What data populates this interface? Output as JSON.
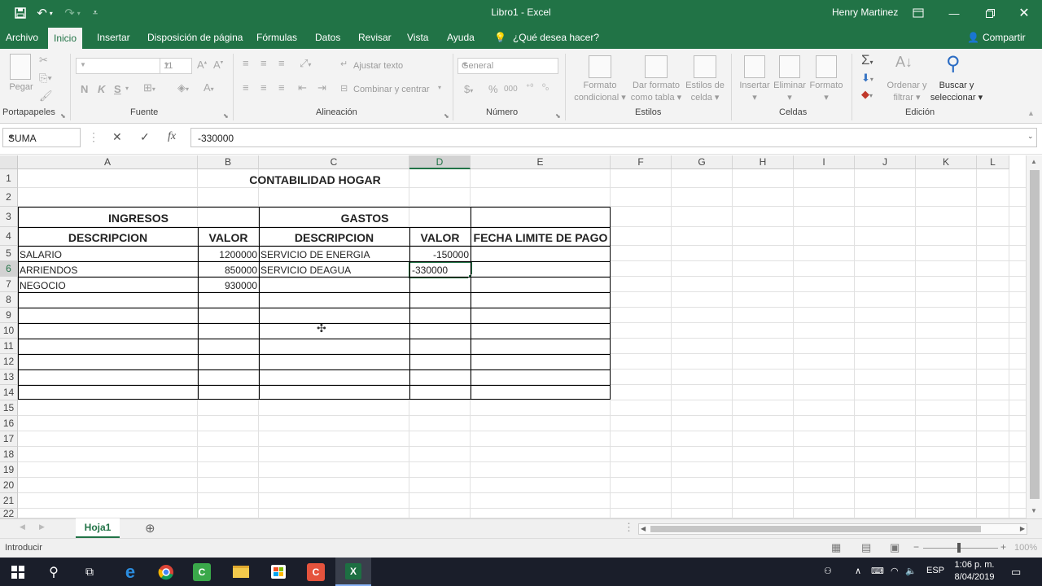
{
  "titlebar": {
    "title": "Libro1  -  Excel",
    "user": "Henry Martinez",
    "colors": {
      "brand": "#217346"
    }
  },
  "menu": {
    "tabs": [
      "Archivo",
      "Inicio",
      "Insertar",
      "Disposición de página",
      "Fórmulas",
      "Datos",
      "Revisar",
      "Vista",
      "Ayuda"
    ],
    "active_tab": "Inicio",
    "tellme": "¿Qué desea hacer?",
    "share": "Compartir"
  },
  "ribbon": {
    "groups": {
      "clipboard": "Portapapeles",
      "font": "Fuente",
      "alignment": "Alineación",
      "number": "Número",
      "styles": "Estilos",
      "cells": "Celdas",
      "editing": "Edición"
    },
    "paste": "Pegar",
    "font_size": "11",
    "bold": "N",
    "italic": "K",
    "underline": "S",
    "wrap_text": "Ajustar texto",
    "merge_center": "Combinar y centrar",
    "number_format": "General",
    "currency": "$",
    "percent": "%",
    "thousands": "000",
    "conditional_format": [
      "Formato",
      "condicional"
    ],
    "format_as_table": [
      "Dar formato",
      "como tabla"
    ],
    "cell_styles": [
      "Estilos de",
      "celda"
    ],
    "insert": "Insertar",
    "delete": "Eliminar",
    "format": "Formato",
    "sort_filter": [
      "Ordenar y",
      "filtrar"
    ],
    "find_select": [
      "Buscar y",
      "seleccionar"
    ]
  },
  "formula_bar": {
    "name_box": "SUMA",
    "formula": "-330000",
    "fx": "fx"
  },
  "grid": {
    "columns": [
      "A",
      "B",
      "C",
      "D",
      "E",
      "F",
      "G",
      "H",
      "I",
      "J",
      "K",
      "L"
    ],
    "selected_column": "D",
    "rows": [
      "1",
      "2",
      "3",
      "4",
      "5",
      "6",
      "7",
      "8",
      "9",
      "10",
      "11",
      "12",
      "13",
      "14",
      "15",
      "16",
      "17",
      "18",
      "19",
      "20",
      "21",
      "22"
    ],
    "selected_row": "6",
    "cells": {
      "title": "CONTABILIDAD HOGAR",
      "ingresos": "INGRESOS",
      "gastos": "GASTOS",
      "desc_ing": "DESCRIPCION",
      "valor_ing": "VALOR",
      "desc_gas": "DESCRIPCION",
      "valor_gas": "VALOR",
      "fecha": "FECHA LIMITE DE PAGO",
      "a5": "SALARIO",
      "b5": "1200000",
      "c5": "SERVICIO DE ENERGIA",
      "d5": "-150000",
      "a6": "ARRIENDOS",
      "b6": "850000",
      "c6": "SERVICIO DEAGUA",
      "d6": "-330000",
      "a7": "NEGOCIO",
      "b7": "930000"
    }
  },
  "sheets": {
    "active": "Hoja1",
    "add": "⊕"
  },
  "status": {
    "mode": "Introducir",
    "zoom": "100%"
  },
  "taskbar": {
    "language": "ESP",
    "time": "1:06 p. m.",
    "date": "8/04/2019"
  }
}
